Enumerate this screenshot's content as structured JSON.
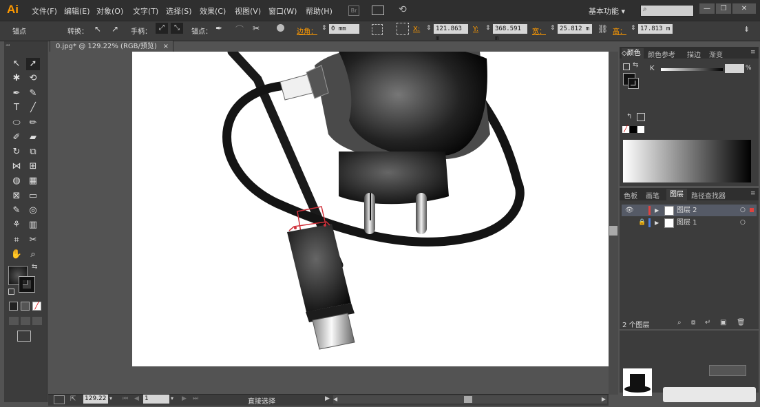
{
  "app": {
    "logo": "Ai"
  },
  "menu": [
    "文件(F)",
    "编辑(E)",
    "对象(O)",
    "文字(T)",
    "选择(S)",
    "效果(C)",
    "视图(V)",
    "窗口(W)",
    "帮助(H)"
  ],
  "menubar_right": {
    "workspace": "基本功能",
    "workspace_arrow": "▾",
    "search_placeholder": ""
  },
  "window_controls": {
    "minimize": "—",
    "restore": "❐",
    "close": "✕"
  },
  "control_bar": {
    "anchor_label": "锚点",
    "convert_label": "转换：",
    "handles_label": "手柄：",
    "anchors_label": "锚点：",
    "corner_label": "边角：",
    "corner_value": "0 mm",
    "x_label": "X:",
    "x_value": "121.863 m",
    "y_label": "Y:",
    "y_value": "368.591 m",
    "w_label": "宽：",
    "w_value": "25.812 m",
    "h_label": "高：",
    "h_value": "17.813 m"
  },
  "document": {
    "tab_title": "0.jpg* @ 129.22% (RGB/预览)",
    "close": "×"
  },
  "status": {
    "zoom": "129.22",
    "page": "1",
    "tool": "直接选择"
  },
  "color_panel": {
    "tabs": [
      "颜色",
      "颜色参考",
      "描边",
      "渐变"
    ],
    "channel_label": "K",
    "channel_unit": "%"
  },
  "layers_panel": {
    "tabs": [
      "色板",
      "画笔",
      "图层",
      "路径查找器"
    ],
    "layers": [
      {
        "name": "图层 2",
        "color": "#e0433f",
        "selected": true
      },
      {
        "name": "图层 1",
        "color": "#4c7ee0",
        "selected": false
      }
    ],
    "count": "2 个图层"
  },
  "colors": {
    "accent": "#ff9a00",
    "menubar": "#2f2f2f",
    "panel": "#3c3c3c",
    "workspace": "#535353"
  }
}
